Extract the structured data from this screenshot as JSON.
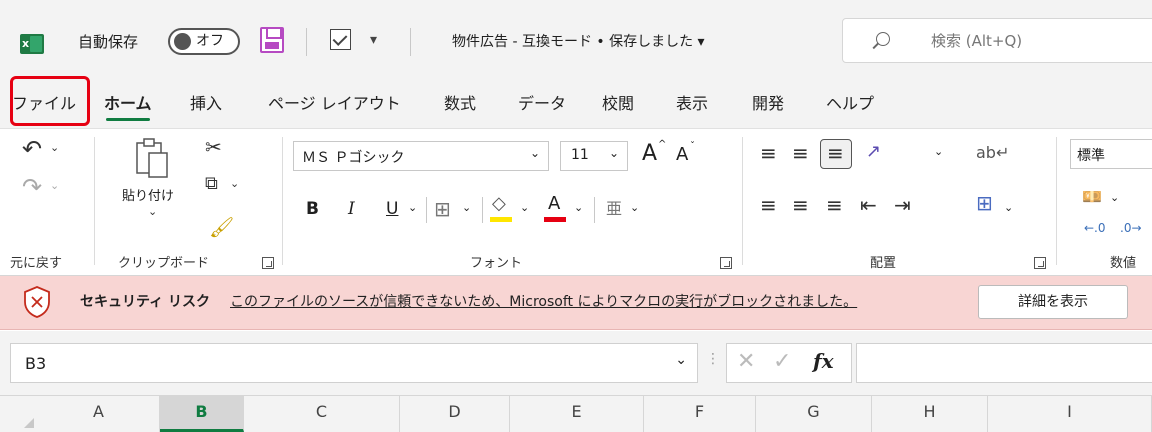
{
  "titlebar": {
    "app_icon_letter": "x",
    "autosave_label": "自動保存",
    "autosave_state": "オフ",
    "qat_more": "▾",
    "document_title": "物件広告 - 互換モード • 保存しました ▾",
    "search_placeholder": "検索 (Alt+Q)"
  },
  "tabs": [
    {
      "label": "ファイル"
    },
    {
      "label": "ホーム"
    },
    {
      "label": "挿入"
    },
    {
      "label": "ページ レイアウト"
    },
    {
      "label": "数式"
    },
    {
      "label": "データ"
    },
    {
      "label": "校閲"
    },
    {
      "label": "表示"
    },
    {
      "label": "開発"
    },
    {
      "label": "ヘルプ"
    }
  ],
  "active_tab": "ホーム",
  "ribbon": {
    "undo": {
      "label": "元に戻す"
    },
    "clipboard": {
      "label": "クリップボード",
      "paste_label": "貼り付け"
    },
    "font": {
      "label": "フォント",
      "font_name": "ＭＳ Ｐゴシック",
      "font_size": "11",
      "increase": "A",
      "decrease": "A",
      "bold": "B",
      "italic": "I",
      "underline": "U",
      "font_color_letter": "A"
    },
    "alignment": {
      "label": "配置"
    },
    "number": {
      "label": "数値",
      "format": "標準"
    }
  },
  "security_bar": {
    "title": "セキュリティ リスク",
    "message": "このファイルのソースが信頼できないため、Microsoft によりマクロの実行がブロックされました。",
    "button": "詳細を表示"
  },
  "formula_bar": {
    "name_box": "B3",
    "fx_label": "fx"
  },
  "columns": [
    "A",
    "B",
    "C",
    "D",
    "E",
    "F",
    "G",
    "H",
    "I"
  ],
  "selected_column": "B",
  "colors": {
    "accent": "#107c41",
    "highlight": "#e60012",
    "security_bg": "#f8d5d3",
    "save_icon": "#b64ac2"
  }
}
